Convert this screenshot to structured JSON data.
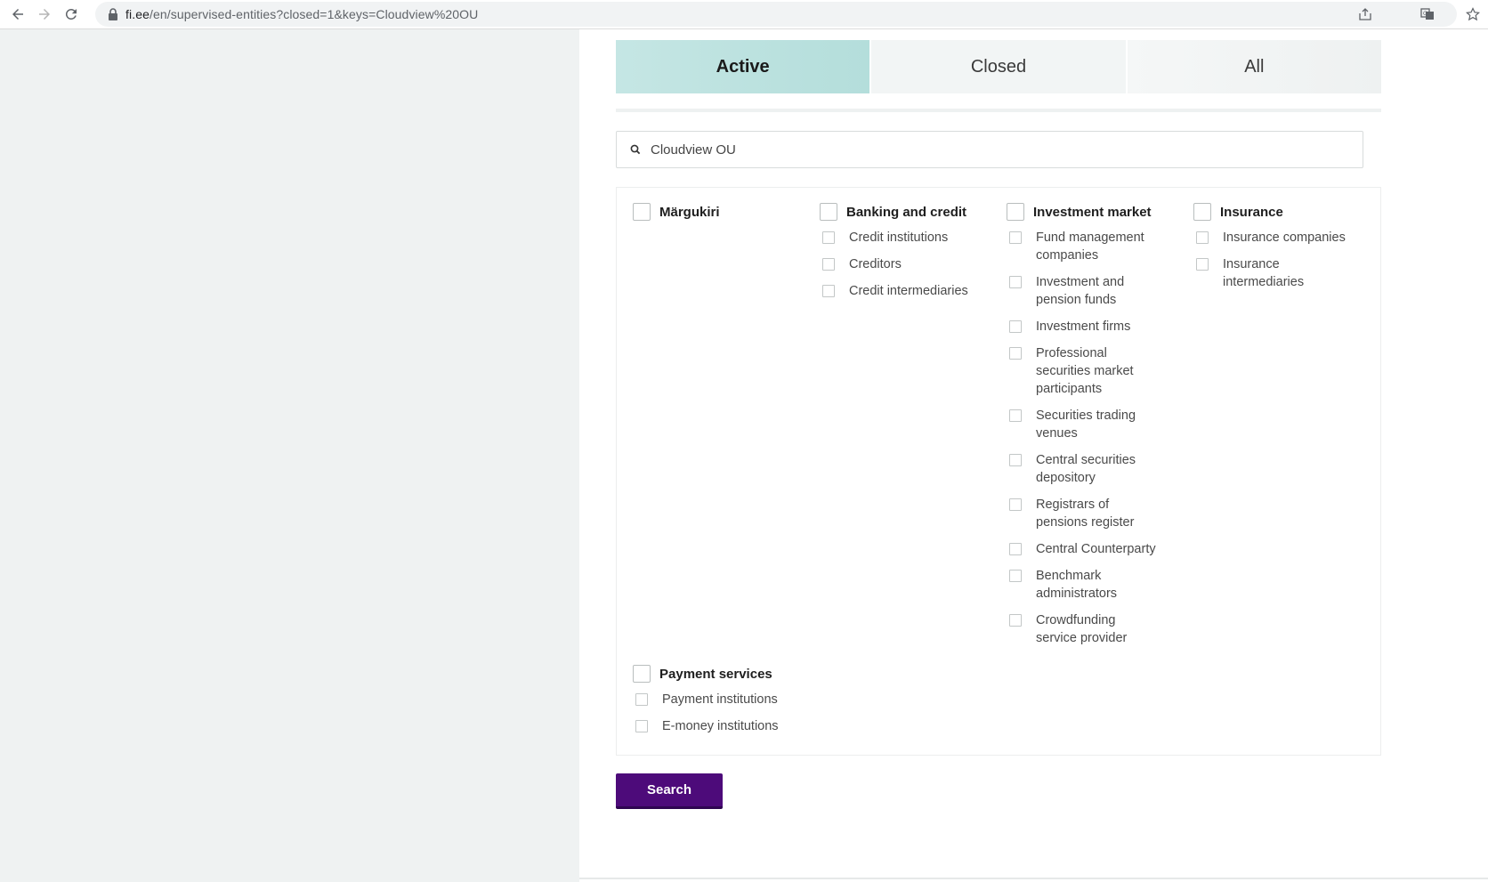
{
  "browser": {
    "url_host": "fi.ee",
    "url_path": "/en/supervised-entities?closed=1&keys=Cloudview%20OU"
  },
  "tabs": [
    {
      "label": "Active",
      "active": true
    },
    {
      "label": "Closed",
      "active": false
    },
    {
      "label": "All",
      "active": false
    }
  ],
  "search": {
    "value": "Cloudview OU",
    "placeholder": ""
  },
  "filters": {
    "margukiri": {
      "title": "Märgukiri",
      "checked": false,
      "items": []
    },
    "banking": {
      "title": "Banking and credit",
      "checked": false,
      "items": [
        "Credit institutions",
        "Creditors",
        "Credit intermediaries"
      ]
    },
    "investment": {
      "title": "Investment market",
      "checked": false,
      "items": [
        "Fund management companies",
        "Investment and pension funds",
        "Investment firms",
        "Professional securities market participants",
        "Securities trading venues",
        "Central securities depository",
        "Registrars of pensions register",
        "Central Counterparty",
        "Benchmark administrators",
        "Crowdfunding service provider"
      ]
    },
    "insurance": {
      "title": "Insurance",
      "checked": false,
      "items": [
        "Insurance companies",
        "Insurance intermediaries"
      ]
    },
    "payment": {
      "title": "Payment services",
      "checked": false,
      "items": [
        "Payment institutions",
        "E-money institutions"
      ]
    }
  },
  "search_button": {
    "label": "Search"
  },
  "colors": {
    "active_tab": "#b4dedb",
    "primary_button": "#4d0b7a",
    "left_panel": "#eff2f2"
  }
}
